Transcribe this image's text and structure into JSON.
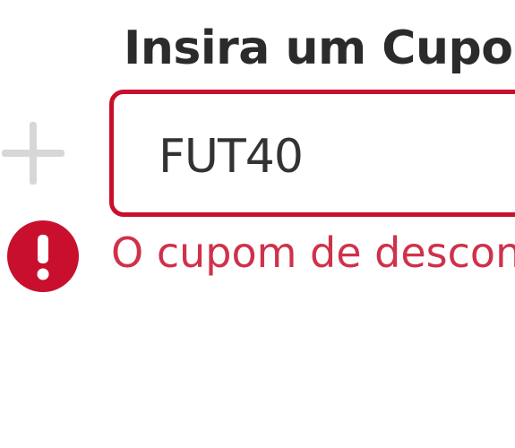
{
  "coupon": {
    "title": "Insira um Cupom",
    "input_value": "FUT40",
    "error_message": "O cupom de desconto"
  },
  "icons": {
    "plus": "plus-icon",
    "error": "exclamation-circle-icon"
  },
  "colors": {
    "accent_error": "#c8102e",
    "error_text": "#d0314a",
    "title_text": "#2b2b2b",
    "plus_icon": "#d7d7d7"
  }
}
